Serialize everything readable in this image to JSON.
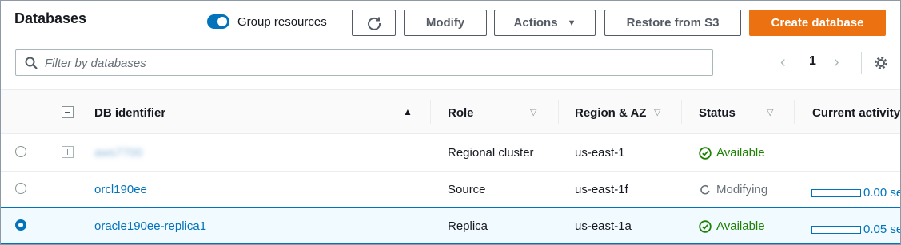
{
  "page": {
    "title": "Databases"
  },
  "toolbar": {
    "group_toggle_label": "Group resources",
    "group_toggle_on": true,
    "modify_label": "Modify",
    "actions_label": "Actions",
    "restore_label": "Restore from S3",
    "create_label": "Create database"
  },
  "search": {
    "placeholder": "Filter by databases",
    "value": ""
  },
  "pagination": {
    "current_page": "1"
  },
  "colors": {
    "accent": "#0073bb",
    "primary_button": "#ec7211",
    "available": "#1d8102",
    "modifying": "#687078"
  },
  "table": {
    "columns": {
      "db_identifier": "DB identifier",
      "role": "Role",
      "region": "Region & AZ",
      "status": "Status",
      "activity": "Current activity"
    },
    "rows": [
      {
        "identifier": "aws7700",
        "identifier_blurred": true,
        "role": "Regional cluster",
        "region": "us-east-1",
        "status": "Available",
        "status_icon": "check-circle-icon",
        "activity": "",
        "selected": false,
        "expandable": true
      },
      {
        "identifier": "orcl190ee",
        "identifier_blurred": false,
        "role": "Source",
        "region": "us-east-1f",
        "status": "Modifying",
        "status_icon": "spinner-icon",
        "activity": "0.00 se",
        "selected": false,
        "expandable": false
      },
      {
        "identifier": "oracle190ee-replica1",
        "identifier_blurred": false,
        "role": "Replica",
        "region": "us-east-1a",
        "status": "Available",
        "status_icon": "check-circle-icon",
        "activity": "0.05 se",
        "selected": true,
        "expandable": false
      }
    ]
  }
}
